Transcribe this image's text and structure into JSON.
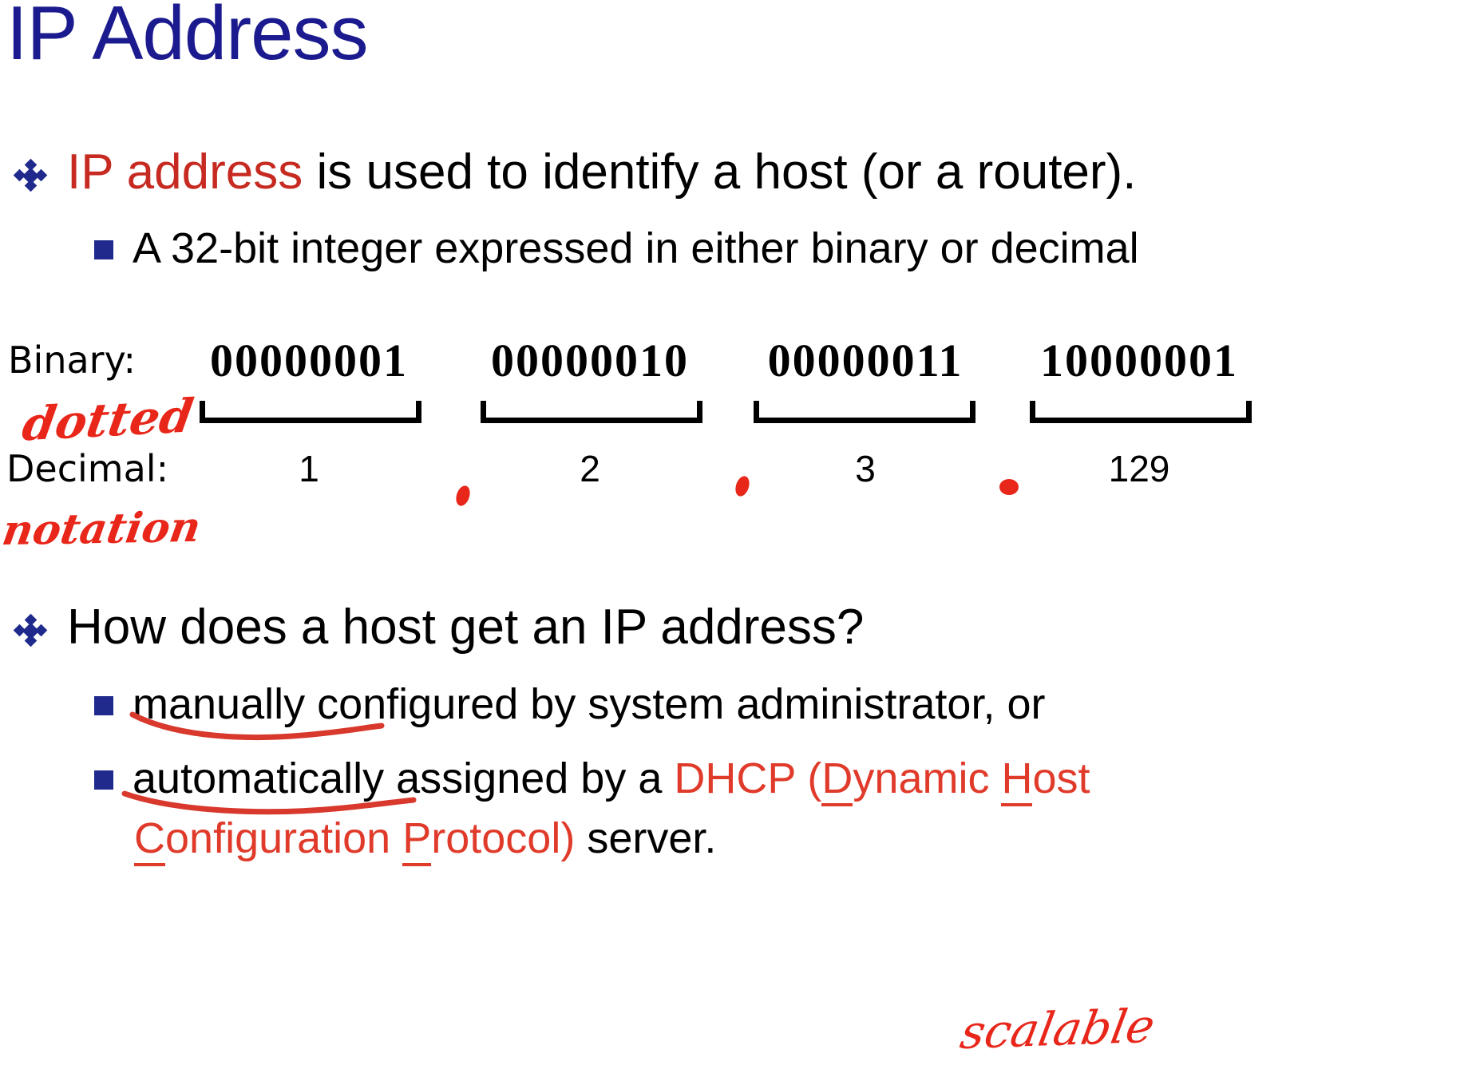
{
  "slide": {
    "title": "IP Address",
    "colors": {
      "title_blue": "#1b1b8f",
      "bullet_blue": "#1f2a8c",
      "highlight_red": "#c62a21",
      "brand_red": "#e03a2a",
      "ink_red": "#e8261a",
      "body_black": "#000000",
      "background": "#ffffff"
    },
    "bullets": [
      {
        "level": 1,
        "marker": "diamond-cluster-bullet",
        "text_parts": [
          {
            "text": "IP address",
            "color": "red"
          },
          {
            "text": " is used to identify a host (or a router).",
            "color": "black"
          }
        ],
        "plain_text": "IP address is used to identify a host (or a router)."
      },
      {
        "level": 2,
        "marker": "square-bullet",
        "plain_text": "A 32-bit integer expressed in either binary or decimal"
      },
      {
        "level": 1,
        "marker": "diamond-cluster-bullet",
        "plain_text": "How does a host get an IP address?"
      },
      {
        "level": 2,
        "marker": "square-bullet",
        "plain_text": "manually configured by system administrator, or"
      },
      {
        "level": 2,
        "marker": "square-bullet",
        "plain_text": "automatically assigned by a DHCP (Dynamic Host Configuration Protocol) server."
      }
    ],
    "lines": {
      "b1_red": "IP address",
      "b1_rest": " is used to identify a host (or a router).",
      "b2": "A 32-bit integer expressed in either binary or decimal",
      "b3": "How does a host get an IP address?",
      "b4": "manually configured by system administrator, or",
      "b5_a": "automatically assigned by a ",
      "b5_dhcp": "DHCP (",
      "b5_d": "D",
      "b5_ynamic": "ynamic ",
      "b5_h": "H",
      "b5_ost": "ost",
      "b6_c": "C",
      "b6_onfiguration": "onfiguration ",
      "b6_p": "P",
      "b6_rotocol": "rotocol)",
      "b6_server": " server."
    },
    "diagram": {
      "binary_label": "Binary:",
      "decimal_label": "Decimal:",
      "octets": [
        {
          "binary": "00000001",
          "decimal": "1"
        },
        {
          "binary": "00000010",
          "decimal": "2"
        },
        {
          "binary": "00000011",
          "decimal": "3"
        },
        {
          "binary": "10000001",
          "decimal": "129"
        }
      ],
      "separators": [
        ".",
        ".",
        "."
      ],
      "separator_style": "handwritten-red-dot"
    },
    "annotations": [
      {
        "id": "dotted",
        "text": "dotted",
        "color": "#e8261a",
        "style": "handwriting"
      },
      {
        "id": "notation",
        "text": "notation",
        "color": "#e8261a",
        "style": "handwriting"
      },
      {
        "id": "scalable",
        "text": "scalable",
        "color": "#e8261a",
        "style": "handwriting"
      }
    ],
    "ink_underlines": [
      {
        "id": "underline-manually",
        "target": "manually"
      },
      {
        "id": "underline-automatically",
        "target": "automatically"
      }
    ]
  }
}
